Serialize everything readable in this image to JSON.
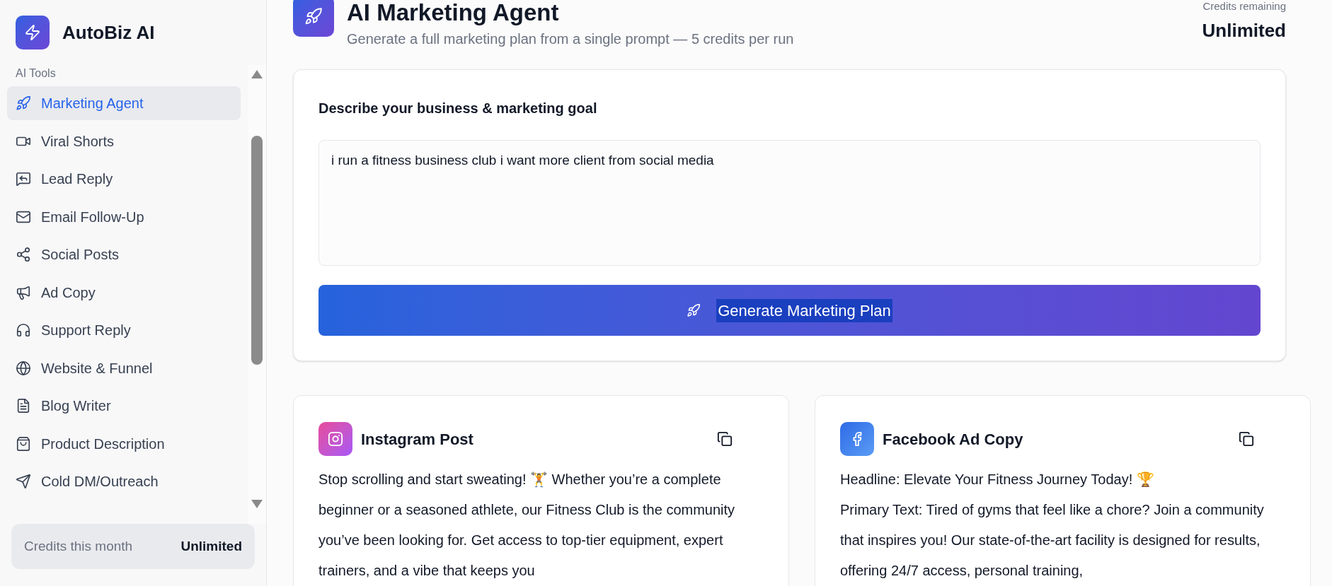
{
  "brand": {
    "name": "AutoBiz AI"
  },
  "sidebar": {
    "section": "AI Tools",
    "items": [
      {
        "label": "Marketing Agent",
        "selected": true
      },
      {
        "label": "Viral Shorts",
        "selected": false
      },
      {
        "label": "Lead Reply",
        "selected": false
      },
      {
        "label": "Email Follow-Up",
        "selected": false
      },
      {
        "label": "Social Posts",
        "selected": false
      },
      {
        "label": "Ad Copy",
        "selected": false
      },
      {
        "label": "Support Reply",
        "selected": false
      },
      {
        "label": "Website & Funnel",
        "selected": false
      },
      {
        "label": "Blog Writer",
        "selected": false
      },
      {
        "label": "Product Description",
        "selected": false
      },
      {
        "label": "Cold DM/Outreach",
        "selected": false
      }
    ],
    "credits": {
      "label": "Credits this month",
      "value": "Unlimited"
    }
  },
  "header": {
    "title": "AI Marketing Agent",
    "subtitle": "Generate a full marketing plan from a single prompt — 5 credits per run",
    "credits_label": "Credits remaining",
    "credits_value": "Unlimited"
  },
  "prompt": {
    "label": "Describe your business & marketing goal",
    "value": "i run a fitness business club i want more client from social media",
    "button": "Generate Marketing Plan"
  },
  "results": [
    {
      "kind": "instagram",
      "title": "Instagram Post",
      "paragraphs": [
        "Stop scrolling and start sweating! 🏋️ Whether you’re a complete beginner or a seasoned athlete, our Fitness Club is the community you’ve been looking for. Get access to top-tier equipment, expert trainers, and a vibe that keeps you"
      ]
    },
    {
      "kind": "facebook",
      "title": "Facebook Ad Copy",
      "paragraphs": [
        "Headline: Elevate Your Fitness Journey Today! 🏆",
        "Primary Text: Tired of gyms that feel like a chore? Join a community that inspires you! Our state-of-the-art facility is designed for results, offering 24/7 access, personal training,"
      ]
    }
  ]
}
